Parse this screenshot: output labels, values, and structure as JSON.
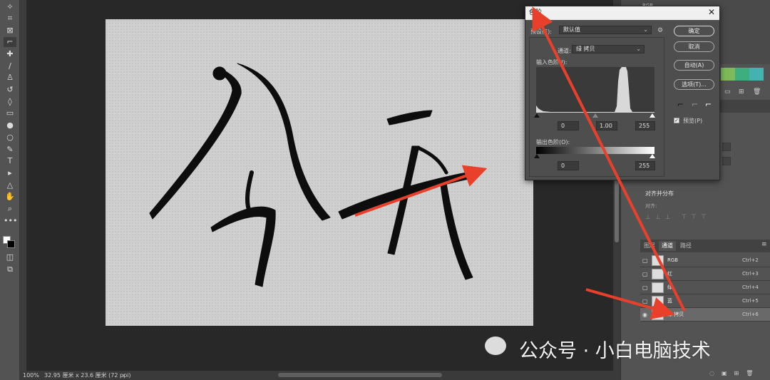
{
  "app": {
    "accent": "#e8402a"
  },
  "toolbar": {
    "tools": [
      "magic-wand-icon",
      "crop-icon",
      "frame-icon",
      "eyedropper-icon",
      "healing-brush-icon",
      "brush-icon",
      "stamp-icon",
      "history-brush-icon",
      "eraser-icon",
      "gradient-icon",
      "blur-icon",
      "dodge-icon",
      "pen-icon",
      "type-icon",
      "path-select-icon",
      "shape-icon",
      "hand-icon",
      "zoom-icon",
      "more-icon"
    ]
  },
  "status": {
    "zoom": "100%",
    "doc_size": "32.95 厘米 x 23.6 厘米 (72 ppi)",
    "arrow": "›"
  },
  "levels_dialog": {
    "title": "色阶",
    "close": "✕",
    "preset_label": "预设(E):",
    "preset_value": "默认值",
    "channel_label": "通道:",
    "channel_value": "绿 拷贝",
    "input_label": "输入色阶(I):",
    "input_black": "0",
    "input_gamma": "1.00",
    "input_white": "255",
    "output_label": "输出色阶(O):",
    "output_black": "0",
    "output_white": "255",
    "buttons": {
      "ok": "确定",
      "cancel": "取消",
      "auto": "自动(A)",
      "options": "选项(T)..."
    },
    "preview_label": "预览(P)",
    "preview_checked": true
  },
  "right_panel": {
    "top_item": "RGB",
    "align_title": "对齐并分布",
    "align_sub": "对齐:",
    "tabs": [
      "图层",
      "通道",
      "路径"
    ],
    "active_tab": 1,
    "channels": [
      {
        "name": "RGB",
        "key": "Ctrl+2",
        "visible": false,
        "selected": false
      },
      {
        "name": "红",
        "key": "Ctrl+3",
        "visible": false,
        "selected": false
      },
      {
        "name": "绿",
        "key": "Ctrl+4",
        "visible": false,
        "selected": false
      },
      {
        "name": "蓝",
        "key": "Ctrl+5",
        "visible": false,
        "selected": false
      },
      {
        "name": "绿 拷贝",
        "key": "Ctrl+6",
        "visible": true,
        "selected": true
      }
    ],
    "swatch_colors": [
      "#7dbb5a",
      "#3fae7e",
      "#44b2b0"
    ]
  },
  "watermark": "公众号 · 小白电脑技术"
}
